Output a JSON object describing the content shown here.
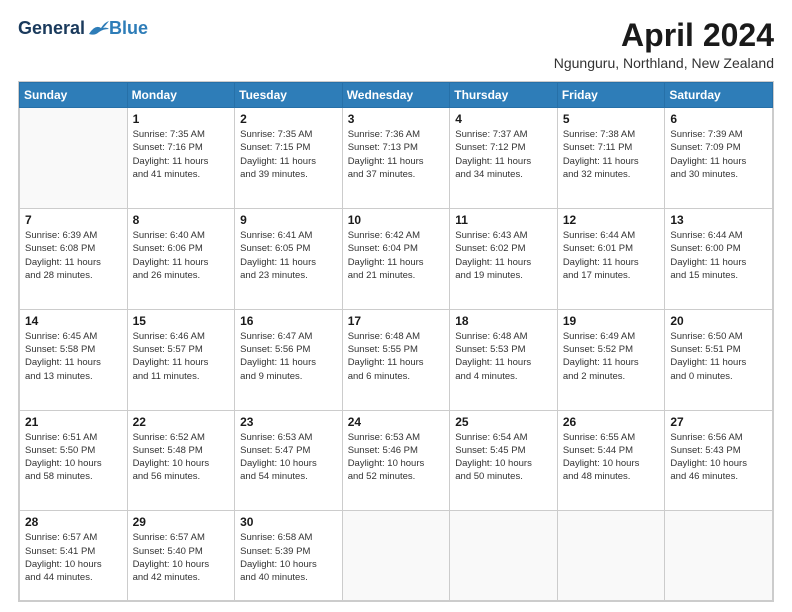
{
  "header": {
    "logo": {
      "general": "General",
      "blue": "Blue"
    },
    "title": "April 2024",
    "location": "Ngunguru, Northland, New Zealand"
  },
  "calendar": {
    "days_of_week": [
      "Sunday",
      "Monday",
      "Tuesday",
      "Wednesday",
      "Thursday",
      "Friday",
      "Saturday"
    ],
    "weeks": [
      [
        {
          "date": "",
          "info": ""
        },
        {
          "date": "1",
          "info": "Sunrise: 7:35 AM\nSunset: 7:16 PM\nDaylight: 11 hours\nand 41 minutes."
        },
        {
          "date": "2",
          "info": "Sunrise: 7:35 AM\nSunset: 7:15 PM\nDaylight: 11 hours\nand 39 minutes."
        },
        {
          "date": "3",
          "info": "Sunrise: 7:36 AM\nSunset: 7:13 PM\nDaylight: 11 hours\nand 37 minutes."
        },
        {
          "date": "4",
          "info": "Sunrise: 7:37 AM\nSunset: 7:12 PM\nDaylight: 11 hours\nand 34 minutes."
        },
        {
          "date": "5",
          "info": "Sunrise: 7:38 AM\nSunset: 7:11 PM\nDaylight: 11 hours\nand 32 minutes."
        },
        {
          "date": "6",
          "info": "Sunrise: 7:39 AM\nSunset: 7:09 PM\nDaylight: 11 hours\nand 30 minutes."
        }
      ],
      [
        {
          "date": "7",
          "info": "Sunrise: 6:39 AM\nSunset: 6:08 PM\nDaylight: 11 hours\nand 28 minutes."
        },
        {
          "date": "8",
          "info": "Sunrise: 6:40 AM\nSunset: 6:06 PM\nDaylight: 11 hours\nand 26 minutes."
        },
        {
          "date": "9",
          "info": "Sunrise: 6:41 AM\nSunset: 6:05 PM\nDaylight: 11 hours\nand 23 minutes."
        },
        {
          "date": "10",
          "info": "Sunrise: 6:42 AM\nSunset: 6:04 PM\nDaylight: 11 hours\nand 21 minutes."
        },
        {
          "date": "11",
          "info": "Sunrise: 6:43 AM\nSunset: 6:02 PM\nDaylight: 11 hours\nand 19 minutes."
        },
        {
          "date": "12",
          "info": "Sunrise: 6:44 AM\nSunset: 6:01 PM\nDaylight: 11 hours\nand 17 minutes."
        },
        {
          "date": "13",
          "info": "Sunrise: 6:44 AM\nSunset: 6:00 PM\nDaylight: 11 hours\nand 15 minutes."
        }
      ],
      [
        {
          "date": "14",
          "info": "Sunrise: 6:45 AM\nSunset: 5:58 PM\nDaylight: 11 hours\nand 13 minutes."
        },
        {
          "date": "15",
          "info": "Sunrise: 6:46 AM\nSunset: 5:57 PM\nDaylight: 11 hours\nand 11 minutes."
        },
        {
          "date": "16",
          "info": "Sunrise: 6:47 AM\nSunset: 5:56 PM\nDaylight: 11 hours\nand 9 minutes."
        },
        {
          "date": "17",
          "info": "Sunrise: 6:48 AM\nSunset: 5:55 PM\nDaylight: 11 hours\nand 6 minutes."
        },
        {
          "date": "18",
          "info": "Sunrise: 6:48 AM\nSunset: 5:53 PM\nDaylight: 11 hours\nand 4 minutes."
        },
        {
          "date": "19",
          "info": "Sunrise: 6:49 AM\nSunset: 5:52 PM\nDaylight: 11 hours\nand 2 minutes."
        },
        {
          "date": "20",
          "info": "Sunrise: 6:50 AM\nSunset: 5:51 PM\nDaylight: 11 hours\nand 0 minutes."
        }
      ],
      [
        {
          "date": "21",
          "info": "Sunrise: 6:51 AM\nSunset: 5:50 PM\nDaylight: 10 hours\nand 58 minutes."
        },
        {
          "date": "22",
          "info": "Sunrise: 6:52 AM\nSunset: 5:48 PM\nDaylight: 10 hours\nand 56 minutes."
        },
        {
          "date": "23",
          "info": "Sunrise: 6:53 AM\nSunset: 5:47 PM\nDaylight: 10 hours\nand 54 minutes."
        },
        {
          "date": "24",
          "info": "Sunrise: 6:53 AM\nSunset: 5:46 PM\nDaylight: 10 hours\nand 52 minutes."
        },
        {
          "date": "25",
          "info": "Sunrise: 6:54 AM\nSunset: 5:45 PM\nDaylight: 10 hours\nand 50 minutes."
        },
        {
          "date": "26",
          "info": "Sunrise: 6:55 AM\nSunset: 5:44 PM\nDaylight: 10 hours\nand 48 minutes."
        },
        {
          "date": "27",
          "info": "Sunrise: 6:56 AM\nSunset: 5:43 PM\nDaylight: 10 hours\nand 46 minutes."
        }
      ],
      [
        {
          "date": "28",
          "info": "Sunrise: 6:57 AM\nSunset: 5:41 PM\nDaylight: 10 hours\nand 44 minutes."
        },
        {
          "date": "29",
          "info": "Sunrise: 6:57 AM\nSunset: 5:40 PM\nDaylight: 10 hours\nand 42 minutes."
        },
        {
          "date": "30",
          "info": "Sunrise: 6:58 AM\nSunset: 5:39 PM\nDaylight: 10 hours\nand 40 minutes."
        },
        {
          "date": "",
          "info": ""
        },
        {
          "date": "",
          "info": ""
        },
        {
          "date": "",
          "info": ""
        },
        {
          "date": "",
          "info": ""
        }
      ]
    ]
  }
}
